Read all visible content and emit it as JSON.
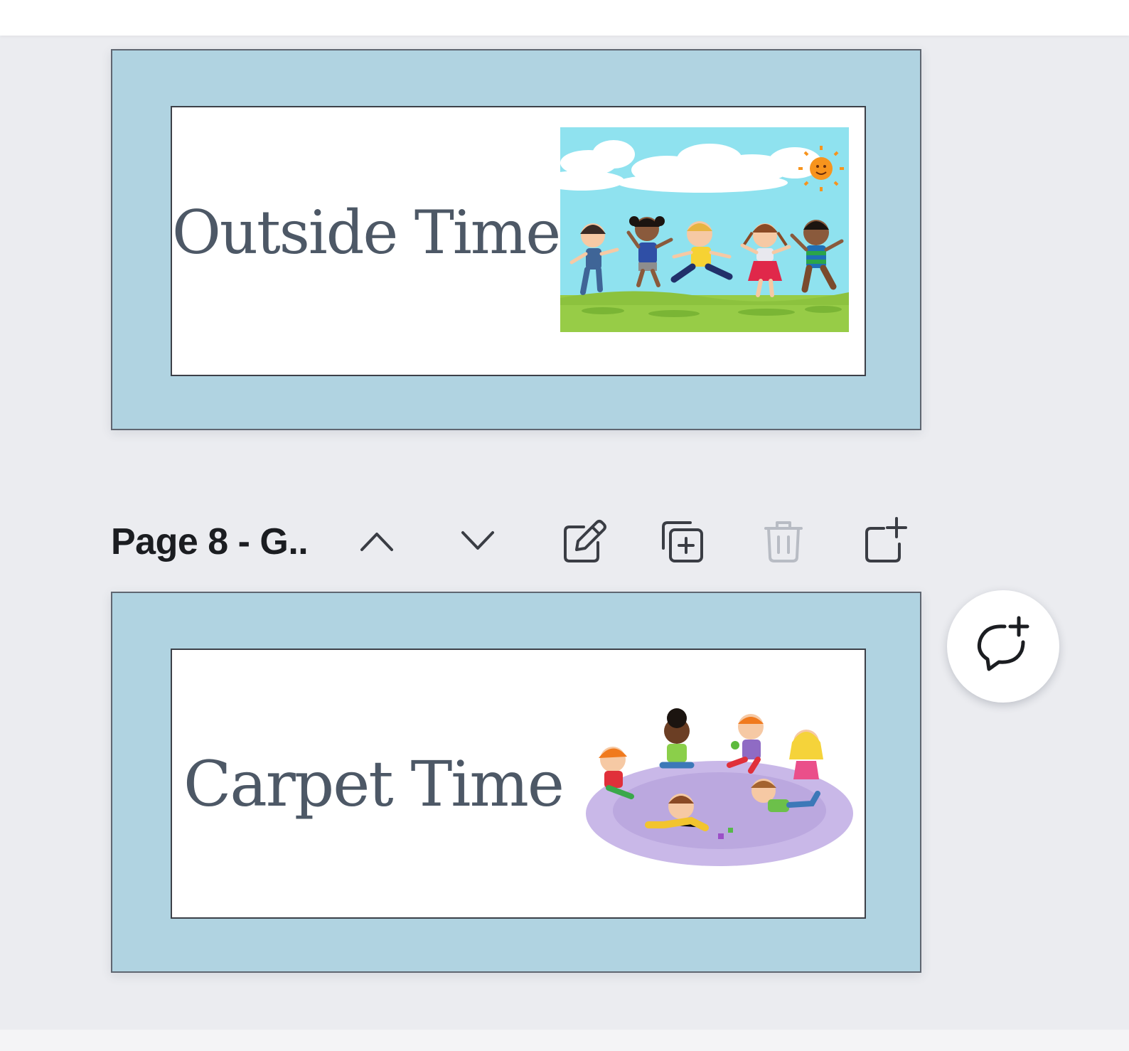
{
  "pages": [
    {
      "title": "Outside Time",
      "image": "kids-jumping-outdoors"
    },
    {
      "title": "Carpet Time",
      "image": "kids-on-carpet"
    }
  ],
  "page_header": {
    "label": "Page 8 - G..",
    "actions": [
      "move-up-icon",
      "move-down-icon",
      "edit-icon",
      "duplicate-icon",
      "delete-icon",
      "add-page-icon"
    ]
  },
  "comment_button": {
    "icon": "add-comment-icon"
  },
  "colors": {
    "canvas_bg": "#ebecf0",
    "page_bg": "#b0d3e1",
    "title_text": "#4d5866",
    "disabled_icon": "#b8bcc4",
    "icon": "#3a3d44"
  }
}
